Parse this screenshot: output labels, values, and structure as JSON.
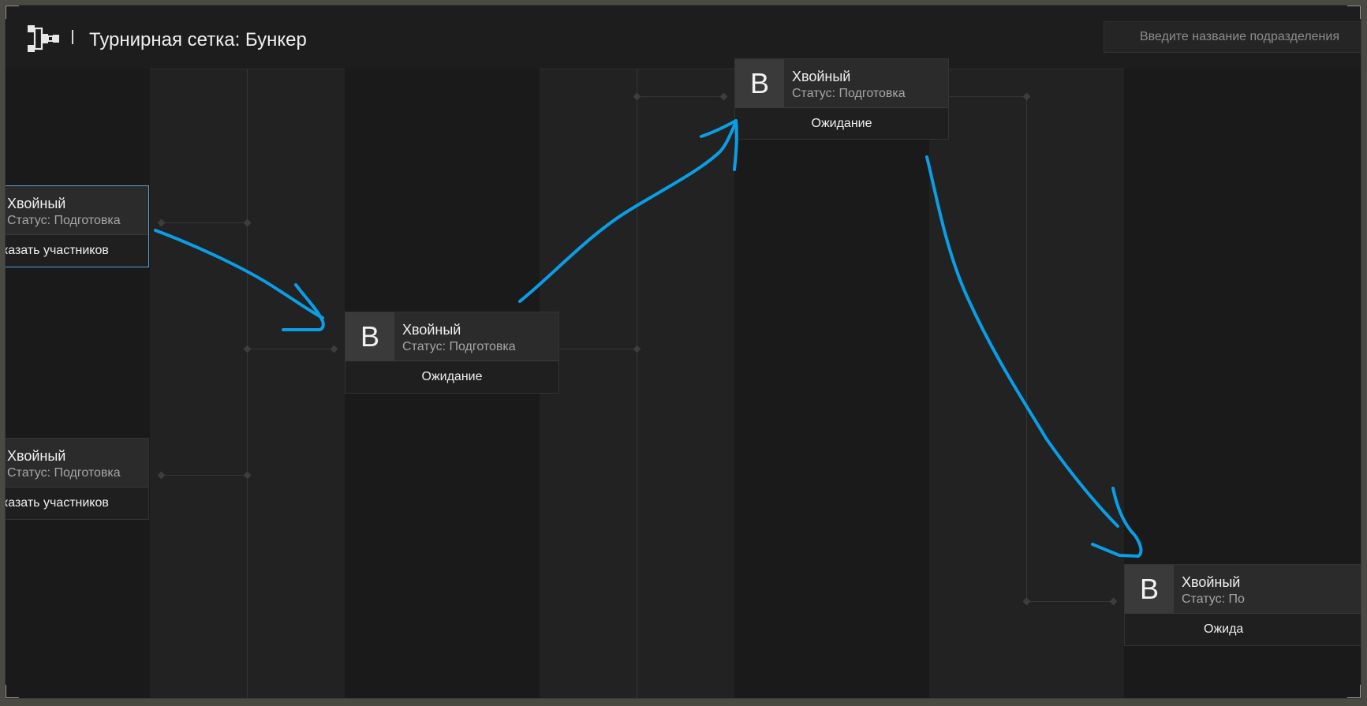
{
  "header": {
    "title": "Турнирная сетка: Бункер",
    "search_placeholder": "Введите название подразделения",
    "icon": "bracket-icon"
  },
  "matches": [
    {
      "badge": "",
      "name": "Хвойный",
      "status": "Статус: Подготовка",
      "action": "оказать участников",
      "selected": true
    },
    {
      "badge": "",
      "name": "Хвойный",
      "status": "Статус: Подготовка",
      "action": "оказать участников",
      "selected": false
    },
    {
      "badge": "В",
      "name": "Хвойный",
      "status": "Статус: Подготовка",
      "action": "Ожидание"
    },
    {
      "badge": "В",
      "name": "Хвойный",
      "status": "Статус: Подготовка",
      "action": "Ожидание"
    },
    {
      "badge": "В",
      "name": "Хвойный",
      "status": "Статус: По",
      "action": "Ожида"
    }
  ],
  "colors": {
    "annotation_arrow": "#0a9ee6",
    "selected_border": "#5aa0d8",
    "background": "#1d1d1d"
  }
}
